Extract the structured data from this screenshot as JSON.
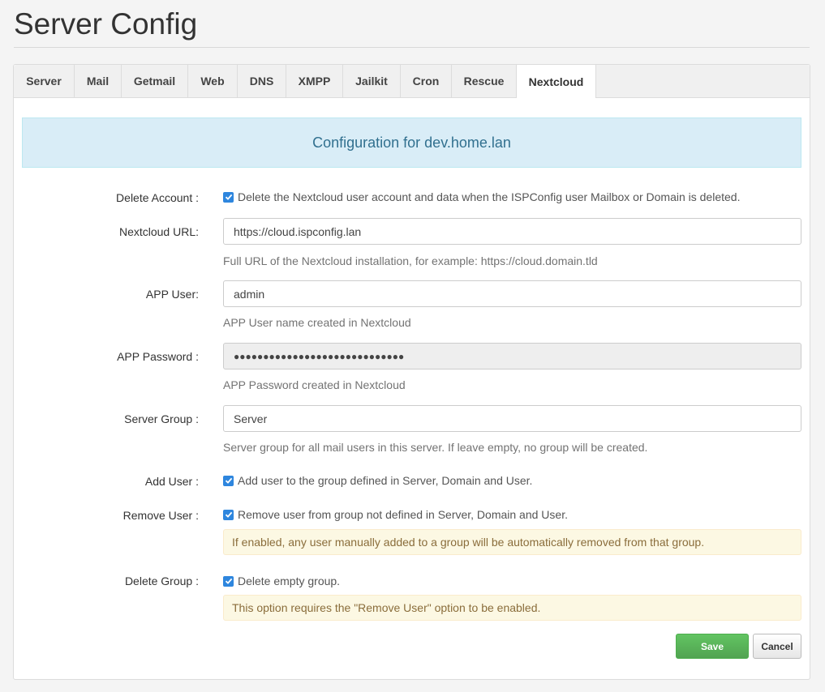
{
  "page": {
    "title": "Server Config"
  },
  "tabs": [
    {
      "label": "Server"
    },
    {
      "label": "Mail"
    },
    {
      "label": "Getmail"
    },
    {
      "label": "Web"
    },
    {
      "label": "DNS"
    },
    {
      "label": "XMPP"
    },
    {
      "label": "Jailkit"
    },
    {
      "label": "Cron"
    },
    {
      "label": "Rescue"
    },
    {
      "label": "Nextcloud",
      "active": true
    }
  ],
  "info": {
    "text": "Configuration for dev.home.lan"
  },
  "form": {
    "delete_account": {
      "label": "Delete Account :",
      "checked": true,
      "text": "Delete the Nextcloud user account and data when the ISPConfig user Mailbox or Domain is deleted."
    },
    "nextcloud_url": {
      "label": "Nextcloud URL:",
      "value": "https://cloud.ispconfig.lan",
      "help": "Full URL of the Nextcloud installation, for example: https://cloud.domain.tld"
    },
    "app_user": {
      "label": "APP User:",
      "value": "admin",
      "help": "APP User name created in Nextcloud"
    },
    "app_password": {
      "label": "APP Password :",
      "value": "●●●●●●●●●●●●●●●●●●●●●●●●●●●●●",
      "help": "APP Password created in Nextcloud"
    },
    "server_group": {
      "label": "Server Group :",
      "value": "Server",
      "help": "Server group for all mail users in this server. If leave empty, no group will be created."
    },
    "add_user": {
      "label": "Add User :",
      "checked": true,
      "text": "Add user to the group defined in Server, Domain and User."
    },
    "remove_user": {
      "label": "Remove User :",
      "checked": true,
      "text": "Remove user from group not defined in Server, Domain and User.",
      "warning": "If enabled, any user manually added to a group will be automatically removed from that group."
    },
    "delete_group": {
      "label": "Delete Group :",
      "checked": true,
      "text": "Delete empty group.",
      "warning": "This option requires the \"Remove User\" option to be enabled."
    }
  },
  "buttons": {
    "save": "Save",
    "cancel": "Cancel"
  },
  "colors": {
    "accent": "#2e86de",
    "save": "#5cb85c",
    "info_bg": "#d9edf7",
    "warn_bg": "#fcf8e3"
  }
}
